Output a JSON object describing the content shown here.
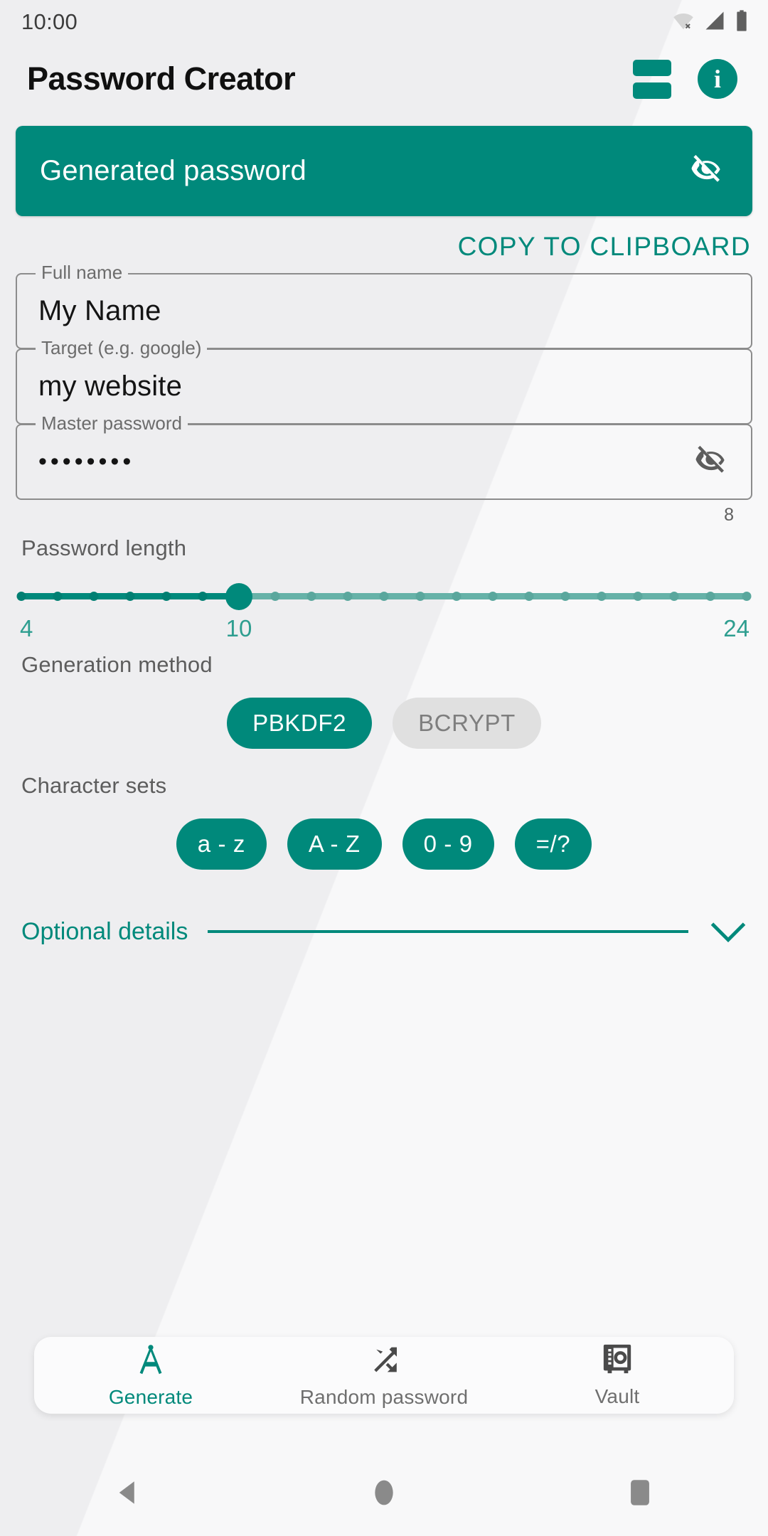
{
  "status_bar": {
    "time": "10:00",
    "icons": [
      "wifi-off-icon",
      "cellular-signal-icon",
      "battery-icon"
    ]
  },
  "app_bar": {
    "title": "Password Creator",
    "actions": [
      {
        "name": "stacked-rows-icon",
        "label": ""
      },
      {
        "name": "info-icon",
        "label": "i"
      }
    ]
  },
  "generated_password": {
    "placeholder": "Generated password",
    "visibility_icon": "eye-off-icon",
    "copy_label": "COPY TO CLIPBOARD"
  },
  "fields": [
    {
      "label": "Full name",
      "value": "My Name",
      "type": "text"
    },
    {
      "label": "Target (e.g. google)",
      "value": "my website",
      "type": "text"
    },
    {
      "label": "Master password",
      "value": "••••••••",
      "type": "password",
      "counter": "8",
      "visibility_icon": "eye-off-icon"
    }
  ],
  "password_length": {
    "label": "Password length",
    "min": 4,
    "max": 24,
    "value": 10,
    "min_label": "4",
    "value_label": "10",
    "max_label": "24"
  },
  "generation_method": {
    "label": "Generation method",
    "options": [
      {
        "label": "PBKDF2",
        "selected": true
      },
      {
        "label": "BCRYPT",
        "selected": false
      }
    ]
  },
  "character_sets": {
    "label": "Character sets",
    "options": [
      {
        "label": "a - z",
        "selected": true
      },
      {
        "label": "A - Z",
        "selected": true
      },
      {
        "label": "0 - 9",
        "selected": true
      },
      {
        "label": "=/?",
        "selected": true
      }
    ]
  },
  "optional_details": {
    "label": "Optional details",
    "expand_icon": "chevron-down-icon",
    "expanded": false
  },
  "bottom_nav": [
    {
      "label": "Generate",
      "icon": "compass-icon",
      "active": true
    },
    {
      "label": "Random password",
      "icon": "shuffle-icon",
      "active": false
    },
    {
      "label": "Vault",
      "icon": "safe-icon",
      "active": false
    }
  ],
  "system_nav": [
    {
      "name": "back-button",
      "icon": "triangle-left-icon"
    },
    {
      "name": "home-button",
      "icon": "circle-icon"
    },
    {
      "name": "recents-button",
      "icon": "square-icon"
    }
  ],
  "colors": {
    "accent": "#00897b",
    "accent_light": "#66b2a8",
    "chip_unselected": "#e0e0e0",
    "background": "#f8f8f9",
    "background_band": "#eeeef0",
    "text_primary": "#141414",
    "text_secondary": "#5d5d5d"
  }
}
